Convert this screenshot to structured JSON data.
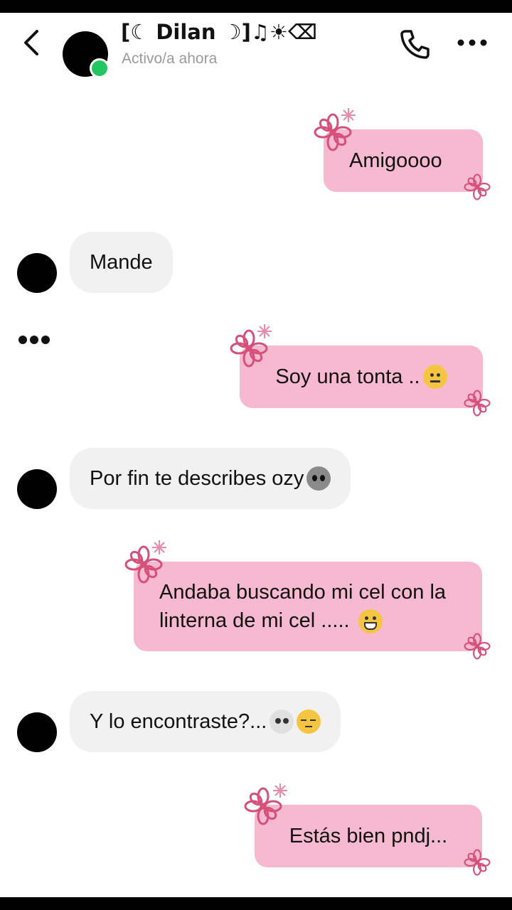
{
  "header": {
    "contact_name": "[☾ Dilan ☽]♫☀⌫",
    "status": "Activo/a ahora"
  },
  "colors": {
    "outgoing_bubble": "#f6b9cf",
    "incoming_bubble": "#f1f1f1",
    "online": "#22c55e",
    "flower": "#d6507a"
  },
  "messages": [
    {
      "direction": "out",
      "text": "Amigoooo"
    },
    {
      "direction": "in",
      "text": "Mande"
    },
    {
      "direction": "out",
      "text": "Soy una tonta ..",
      "emoji": "neutral-face"
    },
    {
      "direction": "in",
      "text": "Por fin te describes ozy",
      "emoji": "alien"
    },
    {
      "direction": "out",
      "text": "Andaba buscando mi cel con la linterna de mi cel .....",
      "emoji": "grinning-sweat"
    },
    {
      "direction": "in",
      "text": "Y lo encontraste?...",
      "emoji": "skull relieved-face"
    },
    {
      "direction": "out",
      "text": "Estás bien pndj..."
    }
  ]
}
